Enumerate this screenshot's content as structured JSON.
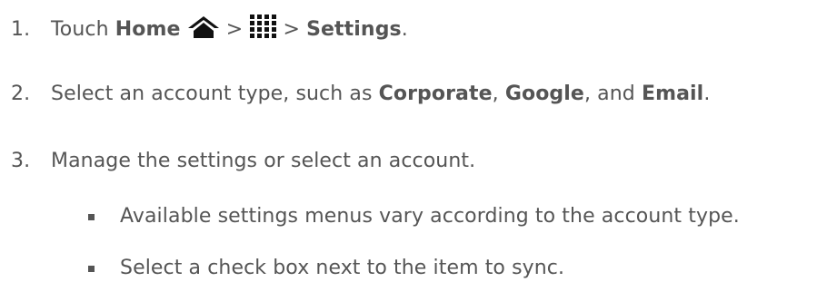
{
  "steps": [
    {
      "number": "1.",
      "touch": "Touch",
      "home": "Home",
      "sep1": ">",
      "sep2": ">",
      "settings": "Settings",
      "end": "."
    },
    {
      "number": "2.",
      "text_a": "Select an account type, such as",
      "corporate": "Corporate",
      "comma1": ",",
      "google": "Google",
      "text_b": ", and",
      "email": "Email",
      "end": "."
    },
    {
      "number": "3.",
      "text": "Manage the settings or select an account."
    }
  ],
  "bullets": [
    "Available settings menus vary according to the account type.",
    "Select a check box next to the item to sync."
  ],
  "icons": {
    "home": "home-icon",
    "apps": "apps-grid-icon"
  },
  "colors": {
    "text": "#555555",
    "icon": "#111111"
  }
}
